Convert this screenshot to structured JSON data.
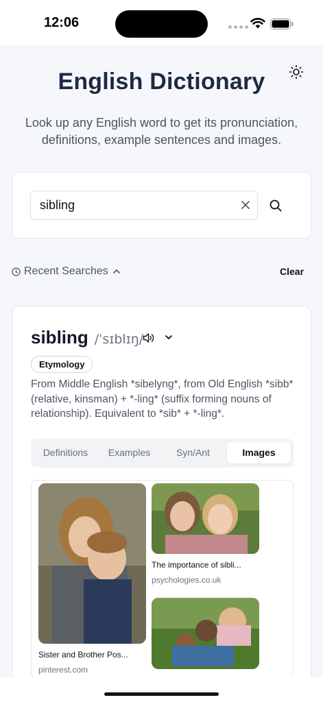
{
  "status": {
    "time": "12:06"
  },
  "header": {
    "title": "English Dictionary",
    "subtitle": "Look up any English word to get its pronunciation, definitions, example sentences and images."
  },
  "search": {
    "value": "sibling",
    "placeholder": ""
  },
  "recent": {
    "label": "Recent Searches",
    "clear_label": "Clear"
  },
  "entry": {
    "word": "sibling",
    "phonetic": "/ˈsɪblɪŋ/",
    "etymology_label": "Etymology",
    "etymology_text": "From Middle English *sibelyng*, from Old English *sibb* (relative, kinsman) + *-ling* (suffix forming nouns of relationship). Equivalent to *sib* + *-ling*."
  },
  "tabs": [
    {
      "label": "Definitions",
      "active": false
    },
    {
      "label": "Examples",
      "active": false
    },
    {
      "label": "Syn/Ant",
      "active": false
    },
    {
      "label": "Images",
      "active": true
    }
  ],
  "images": [
    {
      "caption": "Sister and Brother Pos...",
      "source": "pinterest.com"
    },
    {
      "caption": "The importance of sibli...",
      "source": "psychologies.co.uk"
    },
    {
      "caption": "",
      "source": ""
    }
  ],
  "colors": {
    "title": "#1e2a44",
    "accent_bg": "#f5f7fa",
    "card_border": "#e3e6eb"
  }
}
